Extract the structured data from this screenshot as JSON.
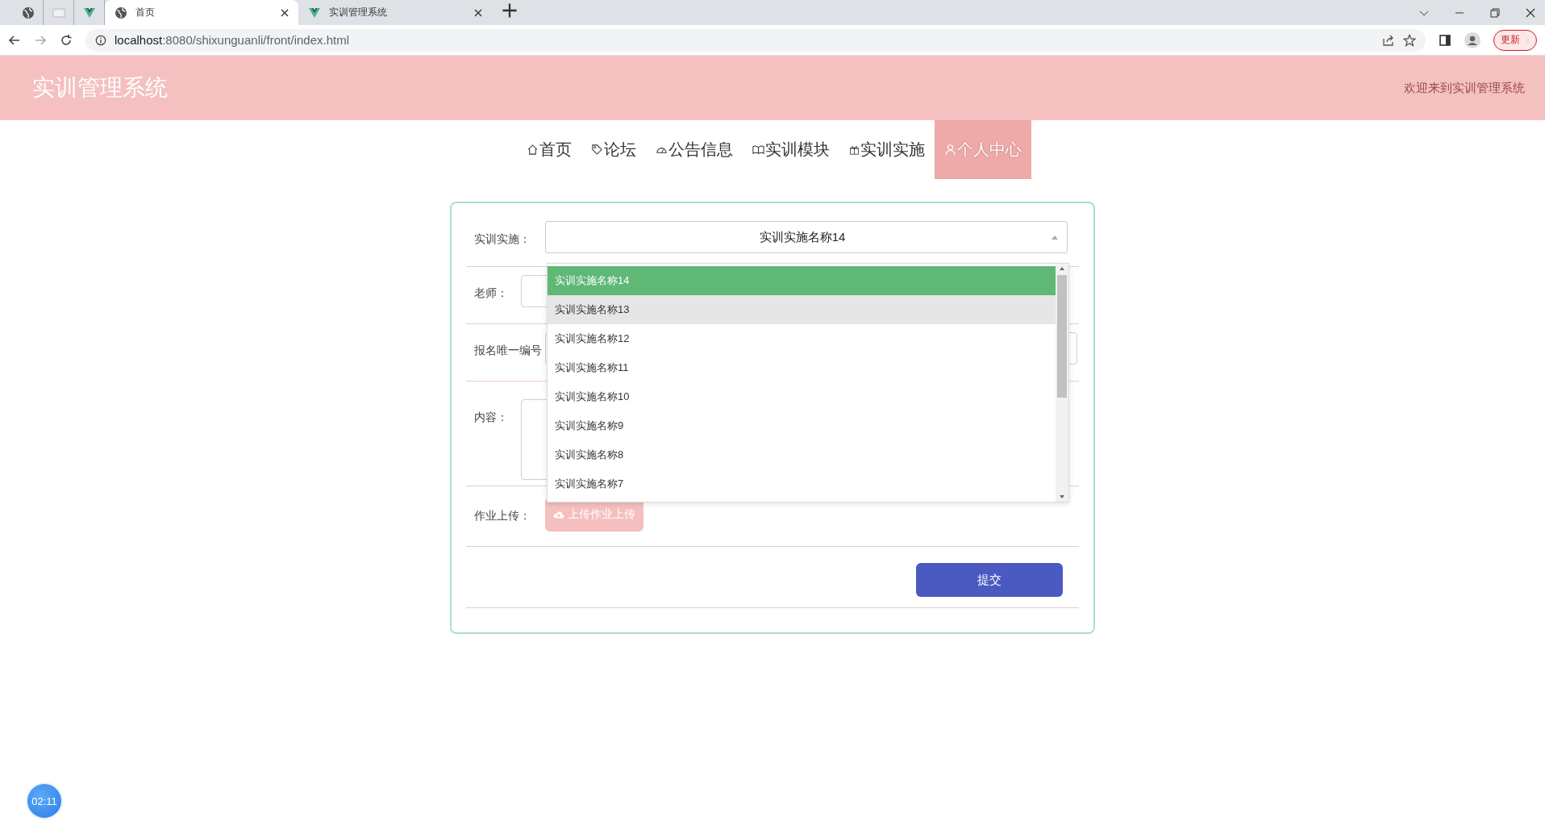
{
  "browser": {
    "tabs": [
      {
        "kind": "globe",
        "title": "首页",
        "selected": true
      },
      {
        "kind": "vue",
        "title": "实训管理系统",
        "selected": false
      }
    ],
    "address": {
      "host": "localhost",
      "rest": ":8080/shixunguanli/front/index.html"
    },
    "update_button": "更新"
  },
  "header": {
    "title": "实训管理系统",
    "welcome": "欢迎来到实训管理系统"
  },
  "nav": [
    {
      "kind": "home",
      "label": "首页",
      "selected": false
    },
    {
      "kind": "tag",
      "label": "论坛",
      "selected": false
    },
    {
      "kind": "gauge",
      "label": "公告信息",
      "selected": false
    },
    {
      "kind": "book",
      "label": "实训模块",
      "selected": false
    },
    {
      "kind": "gift",
      "label": "实训实施",
      "selected": false
    },
    {
      "kind": "user",
      "label": "个人中心",
      "selected": true
    }
  ],
  "form": {
    "fields": [
      {
        "kind": "select",
        "label": "实训实施：",
        "value": "实训实施名称14",
        "expanded": true
      },
      {
        "kind": "input",
        "label": "老师："
      },
      {
        "kind": "input",
        "label": "报名唯一编号"
      },
      {
        "kind": "textarea",
        "label": "内容："
      },
      {
        "kind": "upload",
        "label": "作业上传：",
        "button": "上传作业上传"
      }
    ],
    "submit": "提交"
  },
  "dropdown": [
    {
      "label": "实训实施名称14",
      "selected": true,
      "hovered": false
    },
    {
      "label": "实训实施名称13",
      "selected": false,
      "hovered": true
    },
    {
      "label": "实训实施名称12",
      "selected": false,
      "hovered": false
    },
    {
      "label": "实训实施名称11",
      "selected": false,
      "hovered": false
    },
    {
      "label": "实训实施名称10",
      "selected": false,
      "hovered": false
    },
    {
      "label": "实训实施名称9",
      "selected": false,
      "hovered": false
    },
    {
      "label": "实训实施名称8",
      "selected": false,
      "hovered": false
    },
    {
      "label": "实训实施名称7",
      "selected": false,
      "hovered": false
    }
  ],
  "timer": "02:11"
}
